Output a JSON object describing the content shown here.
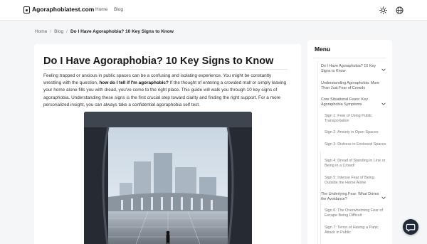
{
  "header": {
    "brand": "Agoraphobiatest.com",
    "nav": [
      {
        "label": "Home"
      },
      {
        "label": "Blog"
      }
    ]
  },
  "breadcrumb": {
    "home": "Home",
    "blog": "Blog",
    "current": "Do I Have Agoraphobia? 10 Key Signs to Know"
  },
  "article": {
    "title": "Do I Have Agoraphobia? 10 Key Signs to Know",
    "intro_start": "Feeling trapped or anxious in public spaces can be a confusing and isolating experience. You might be constantly wrestling with the question, ",
    "intro_bold": "how do I tell if I'm agoraphobic?",
    "intro_end": " If the thought of entering a crowded mall or simply leaving your home alone fills you with dread, you've come to the right place. This guide will walk you through 10 key signs of agoraphobia. Understanding these signs is the first crucial step toward clarity and finding the right support. For a more personalized insight, you can always take a confidential agoraphobia self test."
  },
  "menu": {
    "title": "Menu",
    "items": [
      {
        "label": "Do I Have Agoraphobia? 10 Key Signs to Know",
        "level": 1,
        "expandable": true
      },
      {
        "label": "Understanding Agoraphobia: More Than Just Fear of Crowds",
        "level": 1,
        "expandable": false
      },
      {
        "label": "Core Situational Fears: Key Agoraphobia Symptoms",
        "level": 1,
        "expandable": true
      },
      {
        "label": "Sign 1: Fear of Using Public Transportation",
        "level": 2
      },
      {
        "label": "Sign 2: Anxiety in Open Spaces",
        "level": 2
      },
      {
        "label": "Sign 3: Distress in Enclosed Spaces",
        "level": 2
      },
      {
        "label": "Sign 4: Dread of Standing in Line or Being in a Crowd!",
        "level": 2
      },
      {
        "label": "Sign 5: Intense Fear of Being Outside the Home Alone",
        "level": 2
      },
      {
        "label": "The Underlying Fear: What Drives the Avoidance?",
        "level": 1,
        "expandable": true
      },
      {
        "label": "Sign 6: The Overwhelming Fear of Escape Being Difficult",
        "level": 2
      },
      {
        "label": "Sign 7: Terror of Having a Panic Attack in Public",
        "level": 2
      }
    ]
  },
  "icons": {
    "logo": "brain-icon",
    "theme": "sun-icon",
    "language": "globe-icon",
    "chat": "chat-icon",
    "expand": "chevron-down-icon"
  }
}
